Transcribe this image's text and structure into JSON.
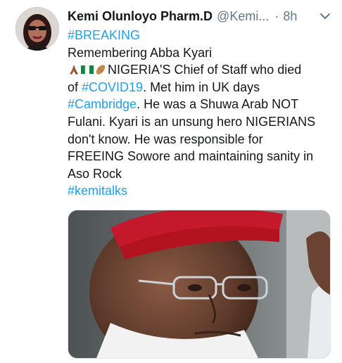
{
  "tweet": {
    "author": {
      "display_name": "Kemi Olunloyo Pharm.D",
      "handle": "@Kemi...",
      "avatar_icon": "profile-avatar"
    },
    "separator": "·",
    "timestamp": "8h",
    "menu_icon": "chevron-down-icon",
    "text": {
      "line1_hashtag": "#BREAKING",
      "line2": "Remembering Abba Kyari",
      "line3_emojis": [
        "folded-hands-icon",
        "nigeria-flag-icon",
        "peanut-icon"
      ],
      "line3_text": "NIGERIA'S Chief of Staff who died",
      "line4_prefix": "of ",
      "line4_hashtag": "#COVID19",
      "line4_suffix": ". Met him in UK days",
      "line5_hashtag": "#Cambridge",
      "line5_suffix": ". He was a Shuwa Arab NOT",
      "line6": "Fulani. Kyari is an unsung hero NIGERIANS",
      "line7": "don't know. He was responsible for",
      "line8": "FREEING Sowore and maintaining sanity in",
      "line9": "Aso Rock",
      "line10_hashtag": "#kemitalks"
    },
    "media": {
      "type": "photo",
      "subject": "man-in-red-cap-photo"
    }
  },
  "colors": {
    "text": "#14171a",
    "muted": "#657786",
    "link": "#1da1f2",
    "border": "#e1e8ed"
  }
}
